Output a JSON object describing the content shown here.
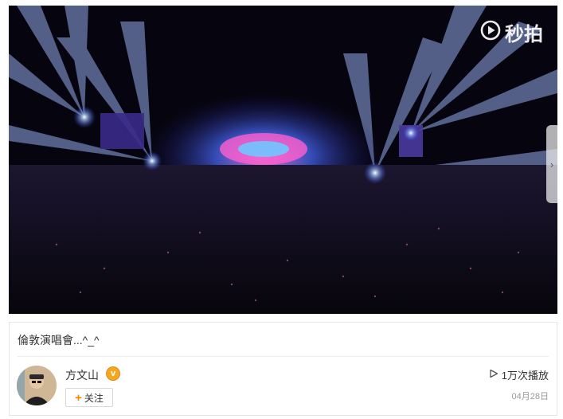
{
  "video": {
    "watermark_text": "秒拍",
    "watermark_icon": "play-circle-icon",
    "next_icon": "chevron-right-icon",
    "next_glyph": "›"
  },
  "post": {
    "title": "倫敦演唱會...^_^",
    "author": {
      "name": "方文山",
      "verified_badge": "v",
      "badge_color": "#f5a623"
    },
    "follow_label": "关注",
    "follow_plus": "+",
    "play_icon": "play-triangle-icon",
    "play_count": "1万次播放",
    "date": "04月28日"
  },
  "colors": {
    "accent": "#ff8200",
    "muted_text": "#999999",
    "border": "#e6e6e6"
  }
}
